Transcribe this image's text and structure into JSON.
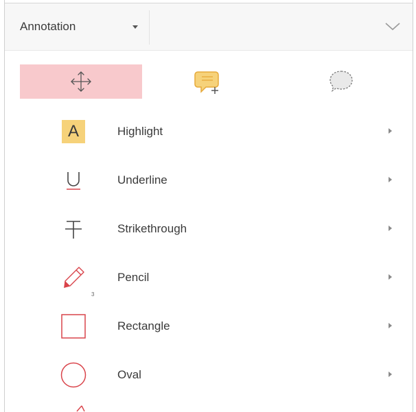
{
  "header": {
    "mode_label": "Annotation"
  },
  "toolbar": {
    "tools": [
      {
        "name": "move",
        "icon": "move-arrows-icon",
        "selected": true
      },
      {
        "name": "add-note",
        "icon": "add-comment-icon"
      },
      {
        "name": "select-comments",
        "icon": "dashed-speech-bubble-icon"
      }
    ],
    "selected_color": "#f8c9cc"
  },
  "tools": [
    {
      "label": "Highlight",
      "icon": "highlight-icon",
      "icon_letter": "A"
    },
    {
      "label": "Underline",
      "icon": "underline-icon",
      "icon_letter": "U"
    },
    {
      "label": "Strikethrough",
      "icon": "strikethrough-icon",
      "icon_letter": "T"
    },
    {
      "label": "Pencil",
      "icon": "pencil-icon",
      "badge": "3"
    },
    {
      "label": "Rectangle",
      "icon": "rectangle-icon"
    },
    {
      "label": "Oval",
      "icon": "oval-icon"
    }
  ],
  "colors": {
    "accent_red": "#d9434a",
    "highlight_yellow": "#f6d27a",
    "note_orange": "#f2b84b"
  }
}
